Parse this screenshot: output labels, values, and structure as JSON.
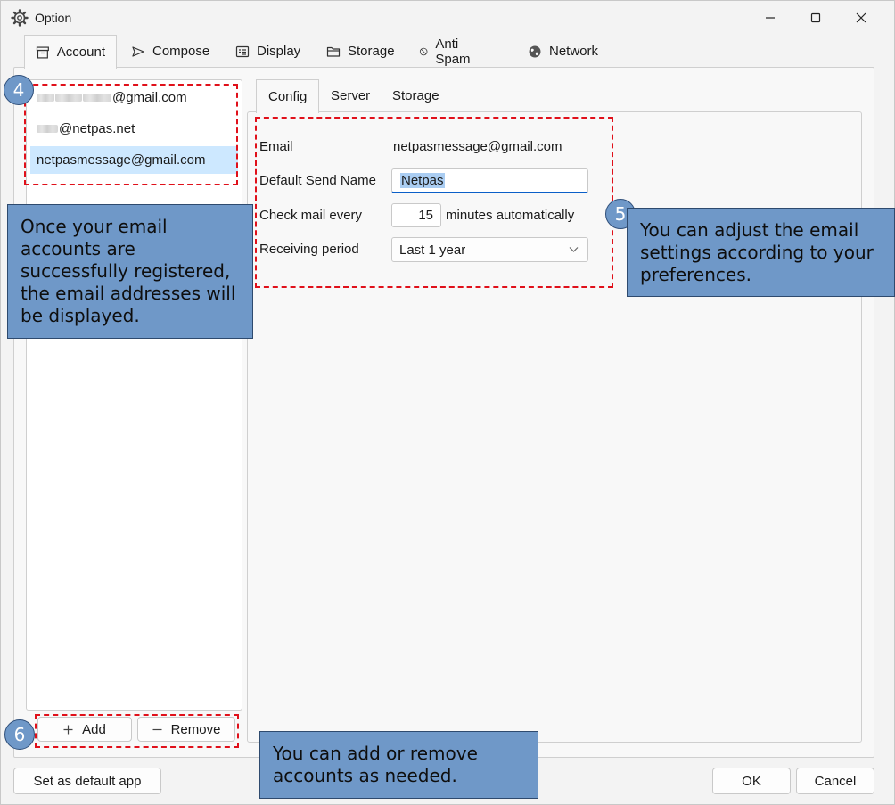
{
  "window": {
    "title": "Option",
    "icon": "gear-icon",
    "controls": {
      "minimize": "minimize-icon",
      "maximize": "maximize-icon",
      "close": "close-icon"
    }
  },
  "top_tabs": [
    {
      "label": "Account",
      "icon": "archive-box-icon",
      "active": true
    },
    {
      "label": "Compose",
      "icon": "send-arrow-icon",
      "active": false
    },
    {
      "label": "Display",
      "icon": "display-list-icon",
      "active": false
    },
    {
      "label": "Storage",
      "icon": "folder-icon",
      "active": false
    },
    {
      "label": "Anti Spam",
      "icon": "block-icon",
      "active": false
    },
    {
      "label": "Network",
      "icon": "globe-icon",
      "active": false
    }
  ],
  "accounts": [
    {
      "text": "@gmail.com",
      "masked": true,
      "selected": false
    },
    {
      "text": "@netpas.net",
      "masked": true,
      "selected": false
    },
    {
      "text": "netpasmessage@gmail.com",
      "masked": false,
      "selected": true
    }
  ],
  "account_buttons": {
    "add": "Add",
    "remove": "Remove"
  },
  "sub_tabs": [
    {
      "label": "Config",
      "active": true
    },
    {
      "label": "Server",
      "active": false
    },
    {
      "label": "Storage",
      "active": false
    }
  ],
  "config": {
    "email_label": "Email",
    "email_value": "netpasmessage@gmail.com",
    "send_name_label": "Default Send Name",
    "send_name_value": "Netpas",
    "check_label": "Check mail every",
    "check_value": "15",
    "check_suffix": "minutes automatically",
    "period_label": "Receiving period",
    "period_value": "Last 1 year"
  },
  "bottom": {
    "default_app": "Set as default app",
    "ok": "OK",
    "cancel": "Cancel"
  },
  "annotations": {
    "step4": "4",
    "step5": "5",
    "step6": "6",
    "note4": "Once your email accounts are successfully registered, the email addresses will be displayed.",
    "note5": "You can adjust the email settings according to your preferences.",
    "note6": "You can add or remove accounts as needed."
  },
  "colors": {
    "selection": "#cde8ff",
    "callout": "#6f98c8",
    "annotation_border": "#e0101a",
    "focus": "#0a5fc8"
  }
}
